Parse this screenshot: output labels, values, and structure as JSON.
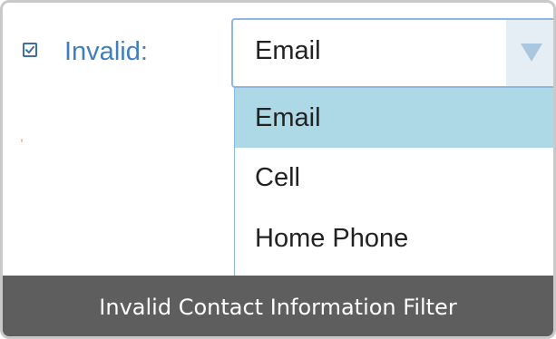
{
  "filter": {
    "checkbox_checked": true,
    "label": "Invalid:",
    "select": {
      "value": "Email",
      "options": [
        {
          "label": "Email",
          "selected": true
        },
        {
          "label": "Cell",
          "selected": false
        },
        {
          "label": "Home Phone",
          "selected": false
        }
      ]
    }
  },
  "caption": {
    "text": "Invalid Contact Information Filter"
  },
  "colors": {
    "label_blue": "#3f7fc0",
    "selected_option_bg": "#add8e6",
    "caption_bar_bg": "#5e5e5e"
  },
  "icons": {
    "checkbox_check": "check-icon",
    "dropdown_arrow": "triangle-down-icon"
  }
}
